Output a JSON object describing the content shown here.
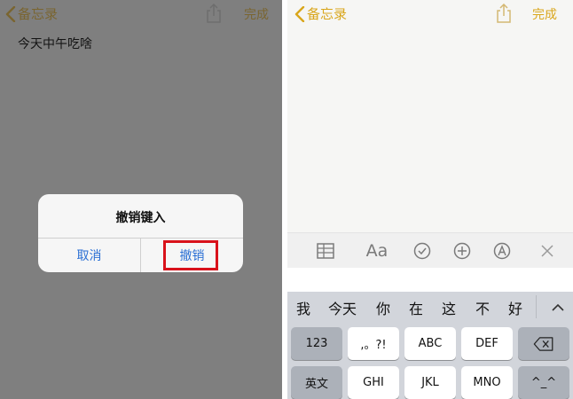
{
  "left_screen": {
    "nav": {
      "back_label": "备忘录",
      "done_label": "完成"
    },
    "note_text": "今天中午吃啥",
    "alert": {
      "title": "撤销键入",
      "cancel_label": "取消",
      "undo_label": "撤销"
    },
    "highlight_color": "#d9121b"
  },
  "right_screen": {
    "nav": {
      "back_label": "备忘录",
      "done_label": "完成"
    },
    "toolbar": {
      "items": [
        "table-icon",
        "Aa",
        "checklist-icon",
        "add-icon",
        "sketch-icon",
        "close-icon"
      ],
      "format_label": "Aa"
    },
    "candidates": [
      "我",
      "今天",
      "你",
      "在",
      "这",
      "不",
      "好"
    ],
    "keyboard": {
      "row1": [
        "123",
        ",。?!",
        "ABC",
        "DEF",
        "delete-icon"
      ],
      "row2": [
        "英文",
        "GHI",
        "JKL",
        "MNO",
        "^_^"
      ]
    }
  },
  "colors": {
    "accent_gold": "#d9a61b",
    "dim_gold": "#7a6530",
    "link_blue": "#2a6fd4",
    "overlay_gray": "#7f7f7f"
  }
}
